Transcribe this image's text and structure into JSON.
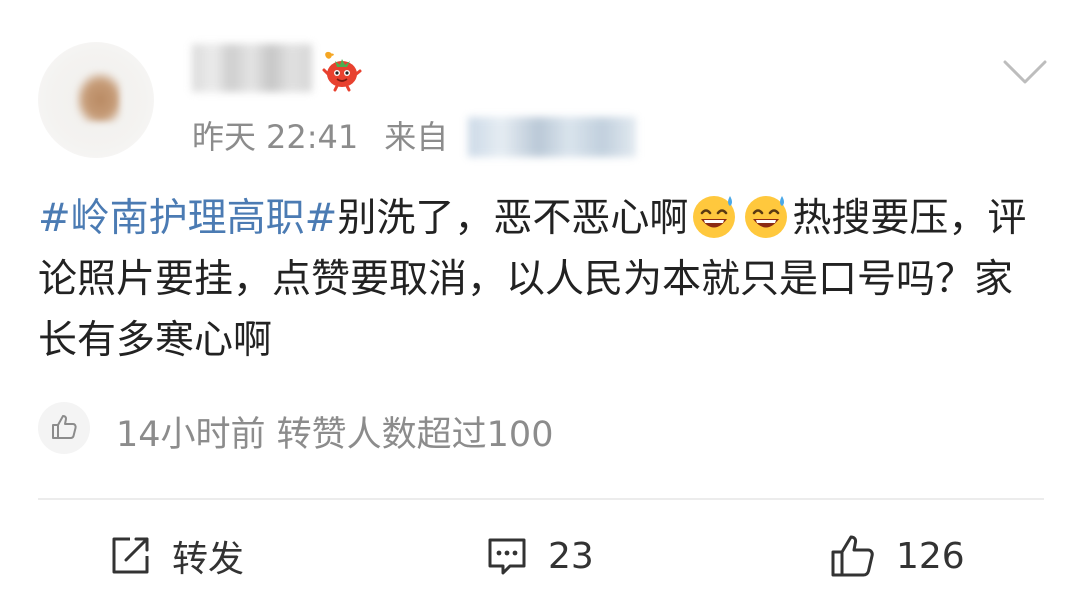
{
  "header": {
    "username": "",
    "time_day": "昨天",
    "time_clock": "22:41",
    "from_label": "来自",
    "source": ""
  },
  "post": {
    "hashtag": "#岭南护理高职#",
    "text1": "别洗了，恶不恶心啊",
    "text2": "热搜要压，评论照片要挂，点赞要取消，以人民为本就只是口号吗？家长有多寒心啊",
    "emoji_name": "sweat-smile-emoji"
  },
  "hot": {
    "text": "14小时前 转赞人数超过100"
  },
  "actions": {
    "repost_label": "转发",
    "comment_count": "23",
    "like_count": "126"
  },
  "colors": {
    "hashtag": "#4b7bb3",
    "meta": "#8c8c8c",
    "divider": "#ececec"
  }
}
